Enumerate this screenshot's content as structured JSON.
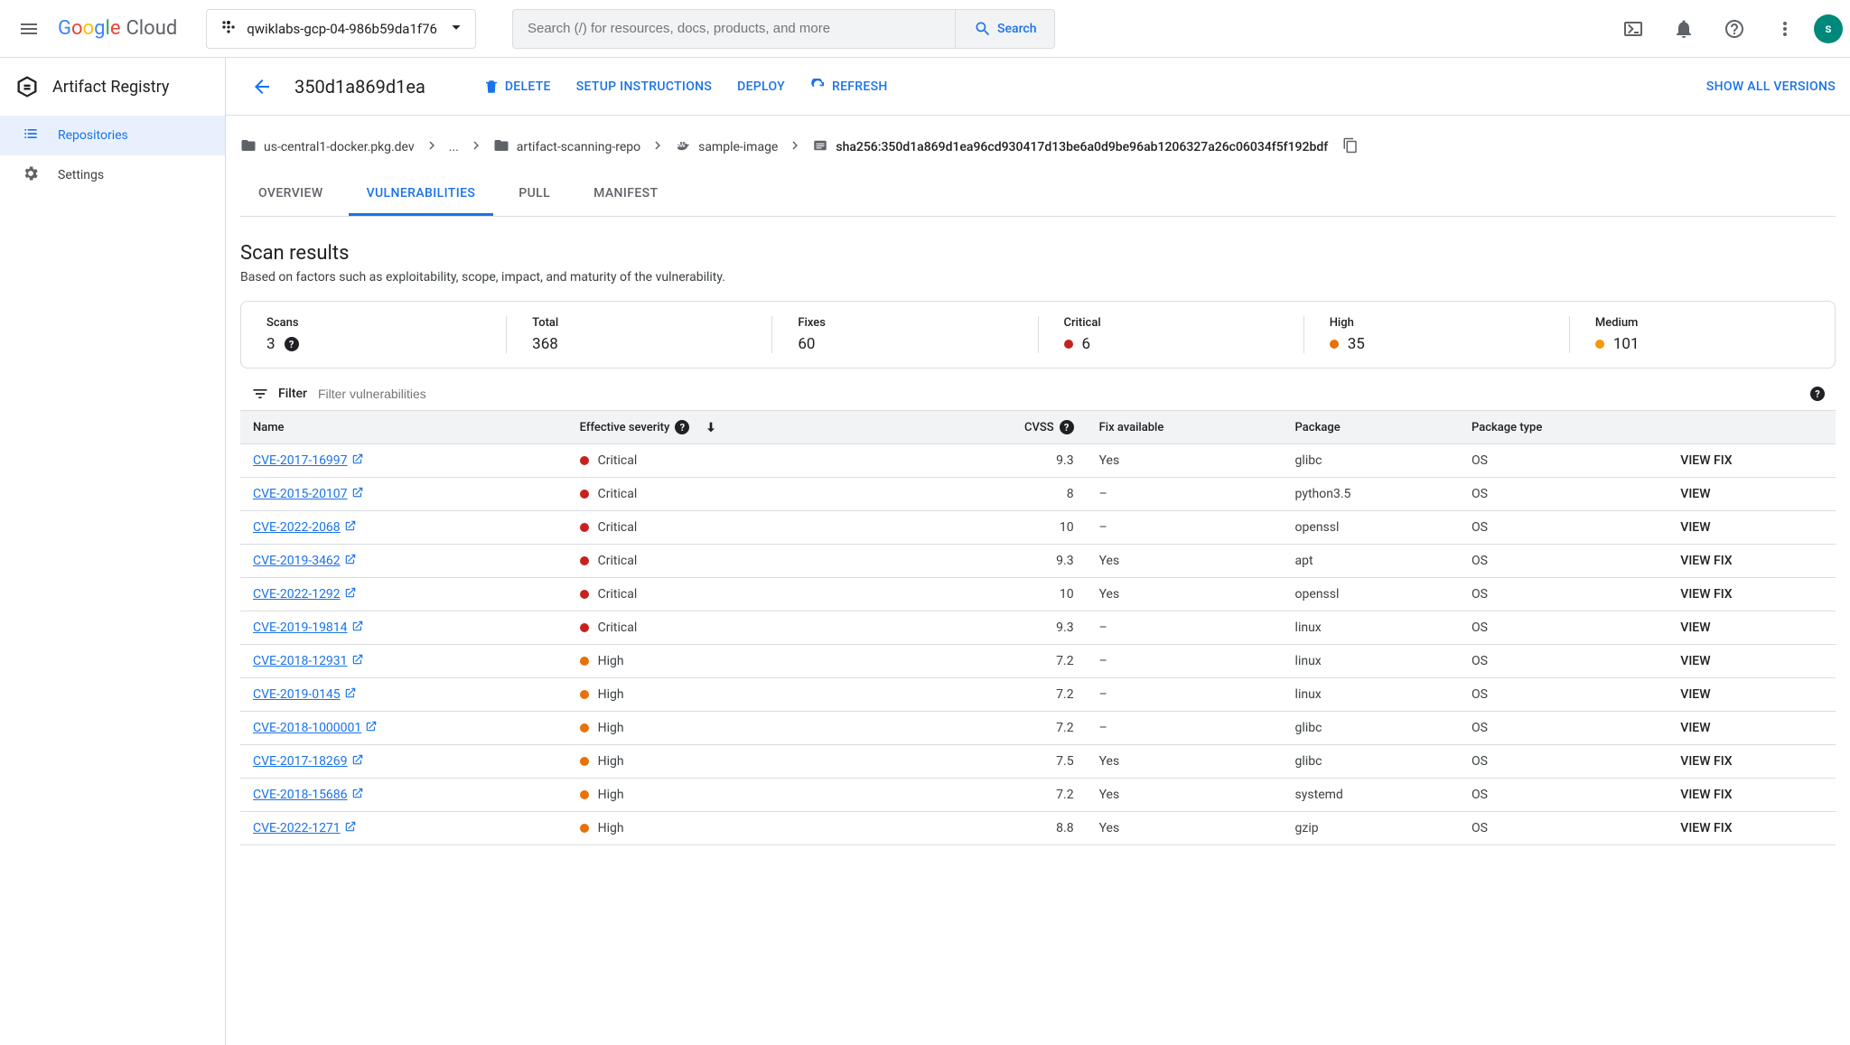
{
  "header": {
    "logo_cloud": "Cloud",
    "project_id": "qwiklabs-gcp-04-986b59da1f76",
    "search_placeholder": "Search (/) for resources, docs, products, and more",
    "search_button": "Search",
    "avatar_initial": "s"
  },
  "sidebar": {
    "product_title": "Artifact Registry",
    "items": [
      {
        "label": "Repositories",
        "icon": "list-icon",
        "selected": true
      },
      {
        "label": "Settings",
        "icon": "gear-icon",
        "selected": false
      }
    ]
  },
  "page": {
    "title": "350d1a869d1ea",
    "actions": {
      "delete": "DELETE",
      "setup": "SETUP INSTRUCTIONS",
      "deploy": "DEPLOY",
      "refresh": "REFRESH",
      "show_all": "SHOW ALL VERSIONS"
    },
    "breadcrumbs": [
      {
        "label": "us-central1-docker.pkg.dev",
        "icon": "folder-icon"
      },
      {
        "label": "...",
        "icon": null
      },
      {
        "label": "artifact-scanning-repo",
        "icon": "folder-icon"
      },
      {
        "label": "sample-image",
        "icon": "docker-icon"
      },
      {
        "label": "sha256:350d1a869d1ea96cd930417d13be6a0d9be96ab1206327a26c06034f5f192bdf",
        "icon": "digest-icon",
        "last": true
      }
    ],
    "tabs": [
      {
        "label": "OVERVIEW",
        "selected": false
      },
      {
        "label": "VULNERABILITIES",
        "selected": true
      },
      {
        "label": "PULL",
        "selected": false
      },
      {
        "label": "MANIFEST",
        "selected": false
      }
    ],
    "section_title": "Scan results",
    "section_subtitle": "Based on factors such as exploitability, scope, impact, and maturity of the vulnerability.",
    "stats": [
      {
        "label": "Scans",
        "value": "3",
        "help": true
      },
      {
        "label": "Total",
        "value": "368"
      },
      {
        "label": "Fixes",
        "value": "60"
      },
      {
        "label": "Critical",
        "value": "6",
        "dot": "red"
      },
      {
        "label": "High",
        "value": "35",
        "dot": "orange"
      },
      {
        "label": "Medium",
        "value": "101",
        "dot": "yellow"
      }
    ],
    "filter": {
      "label": "Filter",
      "placeholder": "Filter vulnerabilities"
    },
    "columns": {
      "name": "Name",
      "severity": "Effective severity",
      "cvss": "CVSS",
      "fix": "Fix available",
      "pkg": "Package",
      "pkgtype": "Package type",
      "actionough": ""
    },
    "rows": [
      {
        "cve": "CVE-2017-16997",
        "sev": "Critical",
        "dot": "red",
        "cvss": "9.3",
        "fix": "Yes",
        "pkg": "glibc",
        "pkgtype": "OS",
        "action": "VIEW FIX"
      },
      {
        "cve": "CVE-2015-20107",
        "sev": "Critical",
        "dot": "red",
        "cvss": "8",
        "fix": "–",
        "pkg": "python3.5",
        "pkgtype": "OS",
        "action": "VIEW"
      },
      {
        "cve": "CVE-2022-2068",
        "sev": "Critical",
        "dot": "red",
        "cvss": "10",
        "fix": "–",
        "pkg": "openssl",
        "pkgtype": "OS",
        "action": "VIEW"
      },
      {
        "cve": "CVE-2019-3462",
        "sev": "Critical",
        "dot": "red",
        "cvss": "9.3",
        "fix": "Yes",
        "pkg": "apt",
        "pkgtype": "OS",
        "action": "VIEW FIX"
      },
      {
        "cve": "CVE-2022-1292",
        "sev": "Critical",
        "dot": "red",
        "cvss": "10",
        "fix": "Yes",
        "pkg": "openssl",
        "pkgtype": "OS",
        "action": "VIEW FIX"
      },
      {
        "cve": "CVE-2019-19814",
        "sev": "Critical",
        "dot": "red",
        "cvss": "9.3",
        "fix": "–",
        "pkg": "linux",
        "pkgtype": "OS",
        "action": "VIEW"
      },
      {
        "cve": "CVE-2018-12931",
        "sev": "High",
        "dot": "orange",
        "cvss": "7.2",
        "fix": "–",
        "pkg": "linux",
        "pkgtype": "OS",
        "action": "VIEW"
      },
      {
        "cve": "CVE-2019-0145",
        "sev": "High",
        "dot": "orange",
        "cvss": "7.2",
        "fix": "–",
        "pkg": "linux",
        "pkgtype": "OS",
        "action": "VIEW"
      },
      {
        "cve": "CVE-2018-1000001",
        "sev": "High",
        "dot": "orange",
        "cvss": "7.2",
        "fix": "–",
        "pkg": "glibc",
        "pkgtype": "OS",
        "action": "VIEW"
      },
      {
        "cve": "CVE-2017-18269",
        "sev": "High",
        "dot": "orange",
        "cvss": "7.5",
        "fix": "Yes",
        "pkg": "glibc",
        "pkgtype": "OS",
        "action": "VIEW FIX"
      },
      {
        "cve": "CVE-2018-15686",
        "sev": "High",
        "dot": "orange",
        "cvss": "7.2",
        "fix": "Yes",
        "pkg": "systemd",
        "pkgtype": "OS",
        "action": "VIEW FIX"
      },
      {
        "cve": "CVE-2022-1271",
        "sev": "High",
        "dot": "orange",
        "cvss": "8.8",
        "fix": "Yes",
        "pkg": "gzip",
        "pkgtype": "OS",
        "action": "VIEW FIX"
      }
    ]
  }
}
